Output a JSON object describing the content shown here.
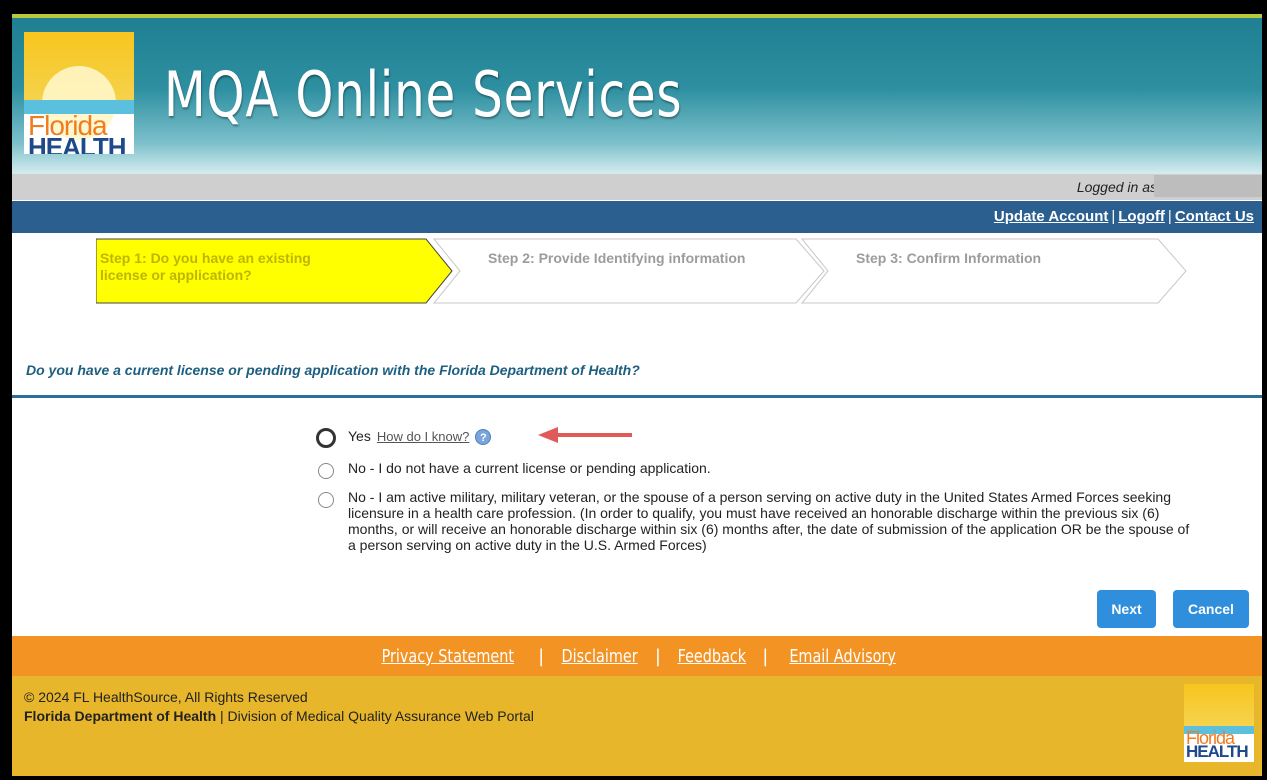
{
  "header": {
    "app_title": "MQA Online Services",
    "logo_top": "Florida",
    "logo_bottom": "HEALTH",
    "logged_in_label": "Logged in as"
  },
  "top_links": {
    "update_account": "Update Account",
    "logoff": "Logoff",
    "contact_us": "Contact Us",
    "separator": "|"
  },
  "steps": [
    {
      "label": "Step 1: Do you have an existing license or application?",
      "state": "active"
    },
    {
      "label": "Step 2: Provide Identifying information",
      "state": "inactive"
    },
    {
      "label": "Step 3: Confirm Information",
      "state": "inactive"
    }
  ],
  "question": "Do you have a current license or pending application with the Florida Department of Health?",
  "options": {
    "yes": "Yes",
    "how_do_i_know": "How do I know?",
    "no_license": "No - I do not have a current license or pending application.",
    "no_military": "No - I am active military, military veteran, or the spouse of a person serving on active duty in the United States Armed Forces seeking licensure in a health care profession. (In order to qualify, you must have received an honorable discharge within the previous six (6) months, or will receive an honorable discharge within six (6) months after, the date of submission of the application OR be the spouse of a person serving on active duty in the U.S. Armed Forces)"
  },
  "buttons": {
    "next": "Next",
    "cancel": "Cancel"
  },
  "footer": {
    "links": {
      "privacy": "Privacy Statement",
      "disclaimer": "Disclaimer",
      "feedback": "Feedback",
      "email_advisory": "Email Advisory",
      "separator": "|"
    },
    "copyright": "© 2024 FL HealthSource, All Rights Reserved",
    "org_bold": "Florida Department of Health",
    "org_rest": " | Division of Medical Quality Assurance Web Portal",
    "logo_top": "Florida",
    "logo_bottom": "HEALTH"
  },
  "colors": {
    "active_step": "#ffff00",
    "accent_blue": "#2b5f8f",
    "button_blue": "#2f8fdc",
    "footer_orange": "#f39324",
    "footer_yellow": "#e8b62a",
    "annotation_arrow": "#e05a5a"
  }
}
